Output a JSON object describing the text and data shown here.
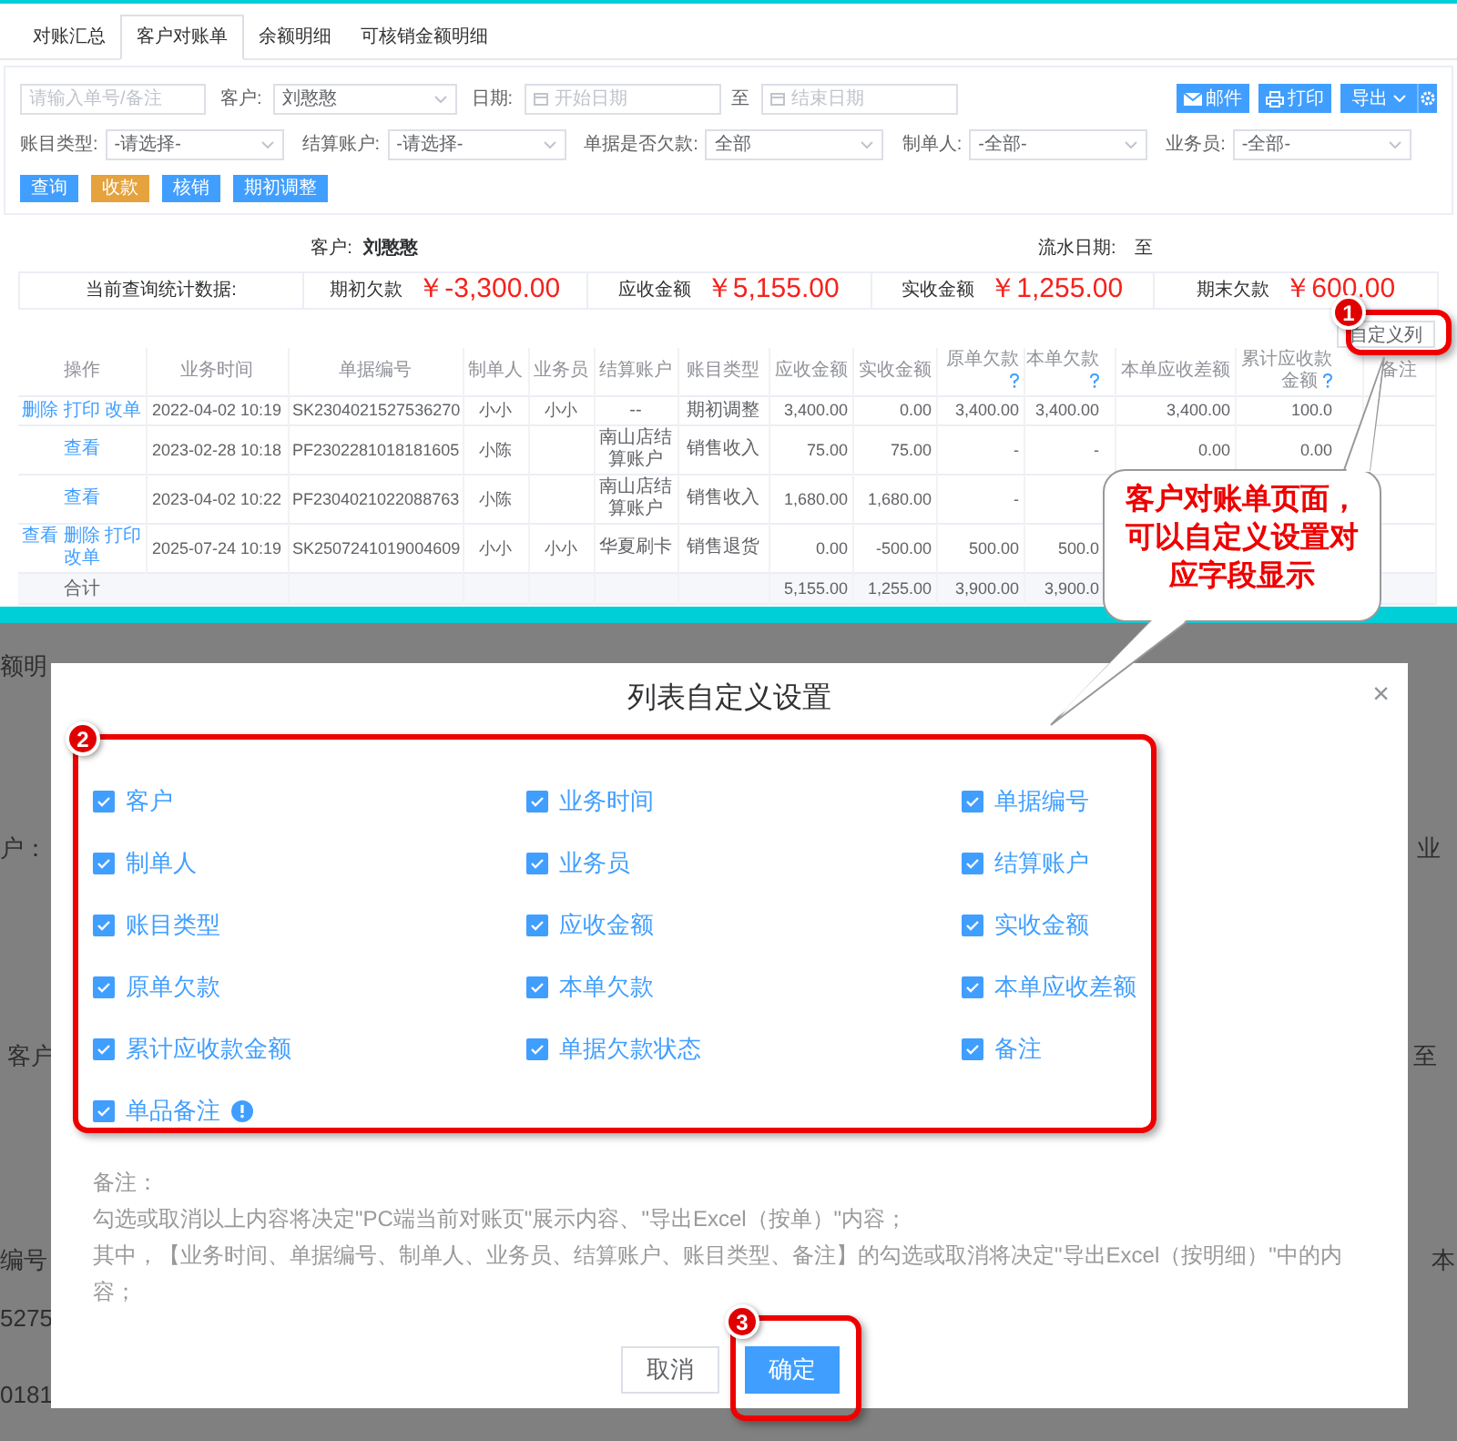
{
  "tabs": [
    {
      "label": "对账汇总",
      "selected": false
    },
    {
      "label": "客户对账单",
      "selected": true
    },
    {
      "label": "余额明细",
      "selected": false
    },
    {
      "label": "可核销金额明细",
      "selected": false
    }
  ],
  "filter_rows": [
    [
      {
        "kind": "input",
        "placeholder": "请输入单号/备注"
      },
      {
        "kind": "select",
        "label": "客户:",
        "value": "刘憨憨"
      },
      {
        "kind": "date_range",
        "label": "日期:",
        "start_placeholder": "开始日期",
        "separator": "至",
        "end_placeholder": "结束日期"
      }
    ],
    [
      {
        "kind": "select",
        "label": "账目类型:",
        "value": "-请选择-"
      },
      {
        "kind": "select",
        "label": "结算账户:",
        "value": "-请选择-"
      },
      {
        "kind": "select",
        "label": "单据是否欠款:",
        "value": "全部"
      },
      {
        "kind": "select",
        "label": "制单人:",
        "value": "-全部-"
      },
      {
        "kind": "select",
        "label": "业务员:",
        "value": "-全部-"
      }
    ]
  ],
  "toolbar_buttons": [
    {
      "kind": "mail",
      "label": "邮件"
    },
    {
      "kind": "print",
      "label": "打印"
    },
    {
      "kind": "dropdown",
      "label": "导出"
    },
    {
      "kind": "settings"
    }
  ],
  "action_buttons": [
    {
      "label": "查询",
      "color": "#409eff"
    },
    {
      "label": "收款",
      "color": "#e6a23c"
    },
    {
      "label": "核销",
      "color": "#409eff"
    },
    {
      "label": "期初调整",
      "color": "#409eff"
    }
  ],
  "summary": {
    "customer_label": "客户:",
    "customer": "刘憨憨",
    "date_label": "流水日期:",
    "date_separator": "至"
  },
  "stats": {
    "title": "当前查询统计数据:",
    "items": [
      {
        "label": "期初欠款",
        "value": "￥-3,300.00"
      },
      {
        "label": "应收金额",
        "value": "￥5,155.00"
      },
      {
        "label": "实收金额",
        "value": "￥1,255.00"
      },
      {
        "label": "期末欠款",
        "value": "￥600.00"
      }
    ]
  },
  "customize_button": {
    "label": "自定义列"
  },
  "table": {
    "action_column": {
      "label": "操作"
    },
    "columns": [
      {
        "label": "业务时间",
        "help": false
      },
      {
        "label": "单据编号",
        "help": false
      },
      {
        "label": "制单人",
        "help": false
      },
      {
        "label": "业务员",
        "help": false
      },
      {
        "label": "结算账户",
        "help": false
      },
      {
        "label": "账目类型",
        "help": false
      },
      {
        "label": "应收金额",
        "help": false
      },
      {
        "label": "实收金额",
        "help": false
      },
      {
        "label": "原单欠款",
        "help": true
      },
      {
        "label": "本单欠款",
        "help": true
      },
      {
        "label": "本单应收差额",
        "help": false
      },
      {
        "label": "累计应收款金额",
        "help": true
      },
      {
        "label": "备注",
        "help": false
      }
    ],
    "rows": [
      {
        "actions": [
          "删除",
          "打印",
          "改单"
        ],
        "cells": [
          "2022-04-02 10:19",
          "SK2304021527536270",
          "小小",
          "小小",
          "--",
          "期初调整",
          "3,400.00",
          "0.00",
          "3,400.00",
          "3,400.00",
          "3,400.00",
          "100.0",
          null
        ]
      },
      {
        "actions": [
          "查看"
        ],
        "cells": [
          "2023-02-28 10:18",
          "PF2302281018181605",
          "小陈",
          null,
          "南山店结算账户",
          "销售收入",
          "75.00",
          "75.00",
          "-",
          "-",
          "0.00",
          "0.00",
          null
        ]
      },
      {
        "actions": [
          "查看"
        ],
        "cells": [
          "2023-04-02 10:22",
          "PF2304021022088763",
          "小陈",
          null,
          "南山店结算账户",
          "销售收入",
          "1,680.00",
          "1,680.00",
          "-",
          null,
          null,
          null,
          null
        ]
      },
      {
        "actions": [
          "查看",
          "删除",
          "打印",
          "改单"
        ],
        "cells": [
          "2025-07-24 10:19",
          "SK2507241019004609",
          "小小",
          "小小",
          "华夏刷卡",
          "销售退货",
          "0.00",
          "-500.00",
          "500.00",
          "500.0",
          null,
          null,
          null
        ]
      }
    ],
    "total": {
      "label": "合计",
      "cells": [
        null,
        null,
        null,
        null,
        null,
        null,
        "5,155.00",
        "1,255.00",
        "3,900.00",
        "3,900.0",
        null,
        null,
        null
      ]
    }
  },
  "background_fragments": [
    "额明",
    "户：",
    "客户",
    "编号",
    "5275",
    "0181",
    "业",
    "至",
    "本"
  ],
  "modal": {
    "title": "列表自定义设置",
    "close": "×",
    "options": [
      {
        "label": "客户",
        "checked": true,
        "info": false
      },
      {
        "label": "业务时间",
        "checked": true,
        "info": false
      },
      {
        "label": "单据编号",
        "checked": true,
        "info": false
      },
      {
        "label": "制单人",
        "checked": true,
        "info": false
      },
      {
        "label": "业务员",
        "checked": true,
        "info": false
      },
      {
        "label": "结算账户",
        "checked": true,
        "info": false
      },
      {
        "label": "账目类型",
        "checked": true,
        "info": false
      },
      {
        "label": "应收金额",
        "checked": true,
        "info": false
      },
      {
        "label": "实收金额",
        "checked": true,
        "info": false
      },
      {
        "label": "原单欠款",
        "checked": true,
        "info": false
      },
      {
        "label": "本单欠款",
        "checked": true,
        "info": false
      },
      {
        "label": "本单应收差额",
        "checked": true,
        "info": false
      },
      {
        "label": "累计应收款金额",
        "checked": true,
        "info": false
      },
      {
        "label": "单据欠款状态",
        "checked": true,
        "info": false
      },
      {
        "label": "备注",
        "checked": true,
        "info": false
      },
      {
        "label": "单品备注",
        "checked": true,
        "info": true
      }
    ],
    "note_title": "备注：",
    "notes": [
      "勾选或取消以上内容将决定\"PC端当前对账页\"展示内容、\"导出Excel（按单）\"内容；",
      "其中，【业务时间、单据编号、制单人、业务员、结算账户、账目类型、备注】的勾选或取消将决定\"导出Excel（按明细）\"中的内容；"
    ],
    "buttons": [
      {
        "label": "取消",
        "kind": "default"
      },
      {
        "label": "确定",
        "kind": "primary"
      }
    ]
  },
  "annotations": {
    "callouts": [
      {
        "number": "1"
      },
      {
        "number": "2"
      },
      {
        "number": "3"
      }
    ],
    "bubble": {
      "text": "客户对账单页面，可以自定义设置对应字段显示"
    }
  }
}
